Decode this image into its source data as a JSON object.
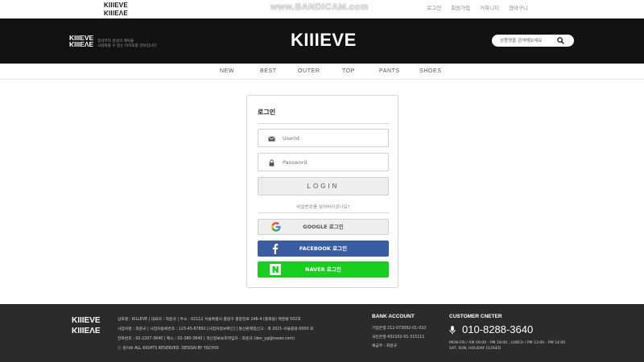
{
  "topbar": {
    "logo": "KIIIEVE",
    "watermark": "www.BANDICAM.com",
    "links": [
      "로그인",
      "회원가입",
      "커뮤니티",
      "장바구니"
    ]
  },
  "header": {
    "logo": "KIIIEVE",
    "tagline_line1": "정석부터 감성의 캐릭을",
    "tagline_line2": "시대와를 수 있는 타이포를 만보입니다",
    "title": "KIIIEVE",
    "search": {
      "placeholder": "상품명을 검색해보세요",
      "icon": "search-icon"
    }
  },
  "nav": {
    "items": [
      "NEW",
      "BEST",
      "OUTER",
      "TOP",
      "PANTS",
      "SHOES"
    ]
  },
  "login": {
    "title": "로그인",
    "userid_placeholder": "UserId",
    "password_placeholder": "Password",
    "button": "LOGIN",
    "forgot": "비밀번호를 잊어버리셨나요?",
    "google": "GOOGLE 로그인",
    "facebook": "FACEBOOK 로그인",
    "naver": "NAVER 로그인"
  },
  "footer": {
    "logo": "KIIIEVE",
    "info": [
      "상호명 : KILLEVE  |  대표자 : 최윤규  |  주소 : 02112 서울특별시 중랑구 중랑천로 146-4 (중화동) 백운빌 502호",
      "사업자명 : 최윤규  |  사업자등록번호 : 123-45-67891 [사업자정보확인]  |  통신판매업신고 : 제 2021-서울중랑-0000 호",
      "전화번호 : 02-2207-3640  |  팩스 : 02-380-3640  |  개인정보보호책임자 : 최윤규 (dev_yg@naver.com)",
      "ⓒ 킬이브 ALL RIGHTS RESERVED. DESIGN BY YGCHOI"
    ],
    "bank_title": "BANK ACCOUNT",
    "bank": [
      "기업은행 212-073092-01-010",
      "국민은행 432102-01-315111",
      "예금주 : 최윤규"
    ],
    "cs_title": "CUSTOMER CNETER",
    "phone": "010-8288-3640",
    "hours_line1": "MON-FRI / AM 09:00 - PM 18:00 ,  LUNCH / PM 13:00 - PM 14:00",
    "hours_line2": "SAT, SUN, HOLIDAY CLOSED"
  },
  "colors": {
    "header_bg": "#121212",
    "footer_bg": "#2b2b2b",
    "facebook": "#3a5ca3",
    "naver": "#19ce1e"
  }
}
